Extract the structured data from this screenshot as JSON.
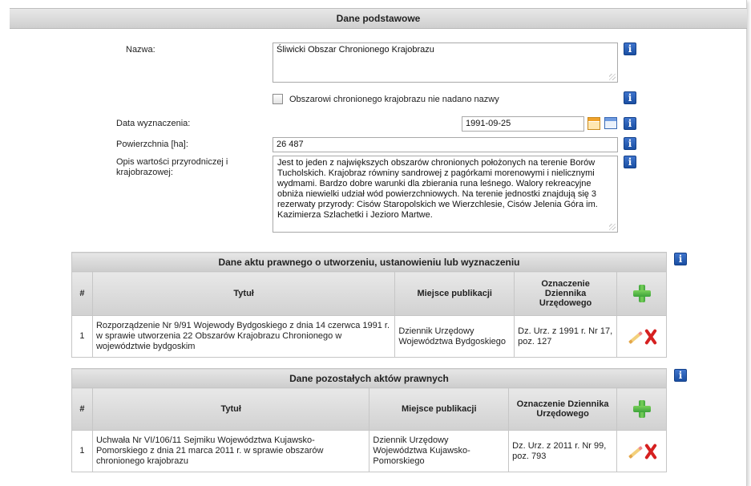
{
  "panel": {
    "title": "Dane podstawowe"
  },
  "form": {
    "name_label": "Nazwa:",
    "name_value": "Śliwicki Obszar Chronionego Krajobrazu",
    "no_name_label": "Obszarowi chronionego krajobrazu nie nadano nazwy",
    "date_label": "Data wyznaczenia:",
    "date_value": "1991-09-25",
    "area_label": "Powierzchnia [ha]:",
    "area_value": "26 487",
    "desc_label": "Opis wartości przyrodniczej i krajobrazowej:",
    "desc_value": "Jest to jeden z największych obszarów chronionych położonych na terenie Borów Tucholskich. Krajobraz równiny sandrowej z pagórkami morenowymi i nielicznymi wydmami. Bardzo dobre warunki dla zbierania runa leśnego. Walory rekreacyjne obniża niewielki udział wód powierzchniowych. Na terenie jednostki znajdują się 3 rezerwaty przyrody: Cisów Staropolskich we Wierzchlesie, Cisów Jelenia Góra im. Kazimierza Szlachetki i Jezioro Martwe."
  },
  "table1": {
    "caption": "Dane aktu prawnego o utworzeniu, ustanowieniu lub wyznaczeniu",
    "headers": {
      "num": "#",
      "title": "Tytuł",
      "place": "Miejsce publikacji",
      "journal": "Oznaczenie Dziennika Urzędowego"
    },
    "rows": [
      {
        "num": "1",
        "title": "Rozporządzenie Nr 9/91 Wojewody Bydgoskiego z dnia 14 czerwca 1991 r. w sprawie utworzenia 22 Obszarów Krajobrazu Chronionego w województwie bydgoskim",
        "place": "Dziennik Urzędowy Województwa Bydgoskiego",
        "journal": "Dz. Urz. z 1991 r. Nr 17, poz. 127"
      }
    ]
  },
  "table2": {
    "caption": "Dane pozostałych aktów prawnych",
    "headers": {
      "num": "#",
      "title": "Tytuł",
      "place": "Miejsce publikacji",
      "journal": "Oznaczenie Dziennika Urzędowego"
    },
    "rows": [
      {
        "num": "1",
        "title": "Uchwała Nr VI/106/11 Sejmiku Województwa Kujawsko-Pomorskiego z dnia 21 marca 2011 r. w sprawie obszarów chronionego krajobrazu",
        "place": "Dziennik Urzędowy Województwa Kujawsko-Pomorskiego",
        "journal": "Dz. Urz. z 2011 r. Nr 99, poz. 793"
      }
    ]
  },
  "icons": {
    "info_glyph": "i"
  },
  "colors": {
    "info_blue": "#1a4fa3",
    "add_green": "#3da33a",
    "delete_red": "#d62020"
  }
}
